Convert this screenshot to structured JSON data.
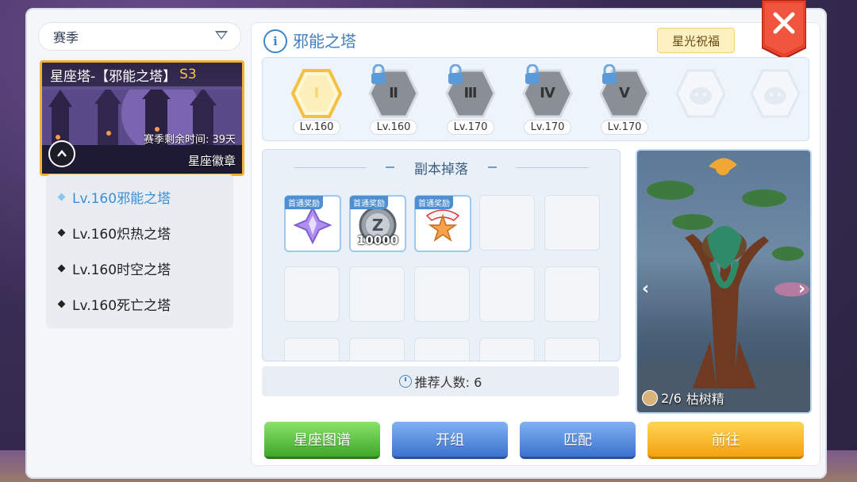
{
  "season_filter": {
    "label": "赛季"
  },
  "tower_card": {
    "title_prefix": "星座塔-【邪能之塔】",
    "season": "S3",
    "remaining": "赛季剩余时间: 39天",
    "badge": "星座徽章"
  },
  "tower_list": [
    {
      "label": "Lv.160邪能之塔",
      "active": true
    },
    {
      "label": "Lv.160炽热之塔",
      "active": false
    },
    {
      "label": "Lv.160时空之塔",
      "active": false
    },
    {
      "label": "Lv.160死亡之塔",
      "active": false
    }
  ],
  "header": {
    "info_icon_text": "i",
    "title": "邪能之塔",
    "blessing_button": "星光祝福",
    "close_icon": "close-icon"
  },
  "floors": [
    {
      "numeral": "Ⅰ",
      "level": "Lv.160",
      "locked": false,
      "active": true
    },
    {
      "numeral": "Ⅱ",
      "level": "Lv.160",
      "locked": true,
      "active": false
    },
    {
      "numeral": "Ⅲ",
      "level": "Lv.170",
      "locked": true,
      "active": false
    },
    {
      "numeral": "Ⅳ",
      "level": "Lv.170",
      "locked": true,
      "active": false
    },
    {
      "numeral": "Ⅴ",
      "level": "Lv.170",
      "locked": true,
      "active": false
    }
  ],
  "drops": {
    "title": "副本掉落",
    "items": [
      {
        "tag": "首通奖励",
        "icon": "purple-crystal-icon",
        "qty": ""
      },
      {
        "tag": "首通奖励",
        "icon": "zeny-coin-icon",
        "qty": "10000"
      },
      {
        "tag": "首通奖励",
        "icon": "star-badge-icon",
        "qty": ""
      }
    ]
  },
  "recommend": {
    "text": "推荐人数: 6"
  },
  "boss": {
    "progress": "2/6",
    "name": "枯树精",
    "prev": "‹",
    "next": "›"
  },
  "buttons": {
    "constellation": "星座图谱",
    "open_group": "开组",
    "match": "匹配",
    "go": "前往"
  },
  "colors": {
    "accent": "#3e86c9",
    "card_border": "#f3b033",
    "close_red": "#e8412c"
  }
}
